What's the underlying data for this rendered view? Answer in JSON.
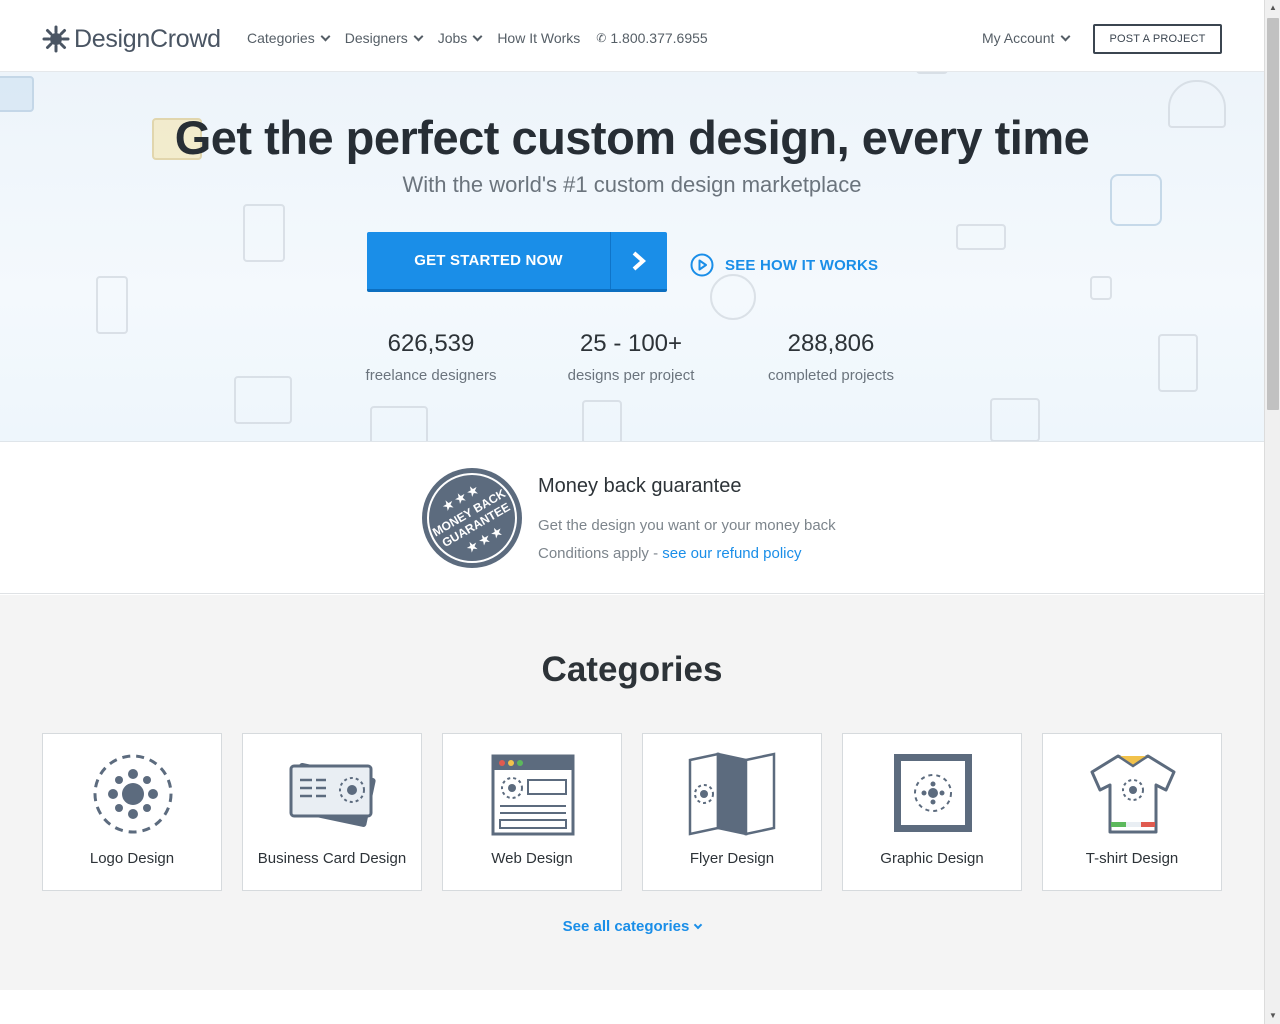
{
  "brand": {
    "name": "DesignCrowd"
  },
  "nav": {
    "items": [
      {
        "label": "Categories",
        "dropdown": true
      },
      {
        "label": "Designers",
        "dropdown": true
      },
      {
        "label": "Jobs",
        "dropdown": true
      },
      {
        "label": "How It Works",
        "dropdown": false
      }
    ],
    "phone": "1.800.377.6955",
    "account_label": "My Account",
    "post_project_label": "POST A PROJECT"
  },
  "hero": {
    "title": "Get the perfect custom design, every time",
    "subtitle": "With the world's #1 custom design marketplace",
    "cta_label": "GET STARTED NOW",
    "how_label": "SEE HOW IT WORKS",
    "stats": [
      {
        "value": "626,539",
        "label": "freelance designers"
      },
      {
        "value": "25 - 100+",
        "label": "designs per project"
      },
      {
        "value": "288,806",
        "label": "completed projects"
      }
    ]
  },
  "guarantee": {
    "badge_text_1": "MONEY BACK",
    "badge_text_2": "GUARANTEE",
    "title": "Money back guarantee",
    "line1": "Get the design you want or your money back",
    "line2_prefix": "Conditions apply - ",
    "line2_link": "see our refund policy"
  },
  "categories": {
    "title": "Categories",
    "items": [
      {
        "label": "Logo Design",
        "icon": "logo-design-icon"
      },
      {
        "label": "Business Card Design",
        "icon": "business-card-icon"
      },
      {
        "label": "Web Design",
        "icon": "web-design-icon"
      },
      {
        "label": "Flyer Design",
        "icon": "flyer-design-icon"
      },
      {
        "label": "Graphic Design",
        "icon": "graphic-design-icon"
      },
      {
        "label": "T-shirt Design",
        "icon": "tshirt-design-icon"
      }
    ],
    "see_all_label": "See all categories"
  },
  "colors": {
    "accent": "#1a8ee8",
    "dark": "#2d3338",
    "icon_slate": "#5c6b7e"
  }
}
